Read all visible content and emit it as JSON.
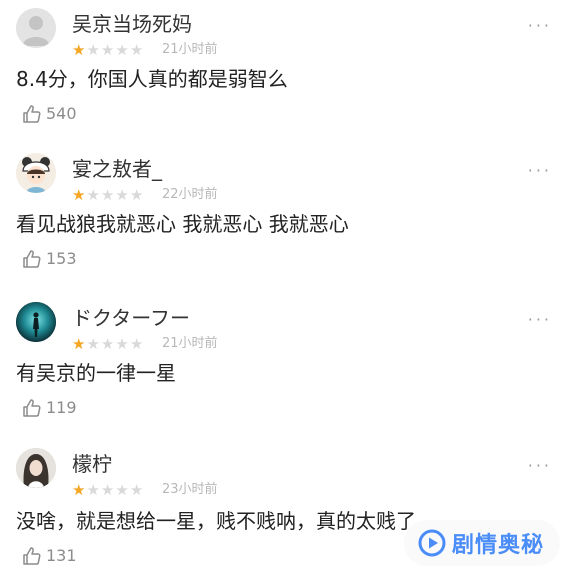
{
  "comments": [
    {
      "username": "吴京当场死妈",
      "rating": 1,
      "time": "21小时前",
      "content": "8.4分，你国人真的都是弱智么",
      "likes": "540",
      "avatar": "default-avatar"
    },
    {
      "username": "宴之敖者_",
      "rating": 1,
      "time": "22小时前",
      "content": "看见战狼我就恶心 我就恶心 我就恶心",
      "likes": "153",
      "avatar": "cartoon-panda-hat-avatar"
    },
    {
      "username": "ドクターフー",
      "rating": 1,
      "time": "21小时前",
      "content": "有吴京的一律一星",
      "likes": "119",
      "avatar": "teal-silhouette-avatar"
    },
    {
      "username": "檬柠",
      "rating": 1,
      "time": "23小时前",
      "content": "没啥，就是想给一星，贱不贱呐，真的太贱了",
      "likes": "131",
      "avatar": "photo-avatar"
    }
  ],
  "max_rating": 5,
  "colors": {
    "star_on": "#f5a623",
    "star_off": "#d9d9d9",
    "watermark": "#4a8df8"
  },
  "watermark": {
    "text": "剧情奥秘",
    "icon": "play-logo-icon"
  }
}
